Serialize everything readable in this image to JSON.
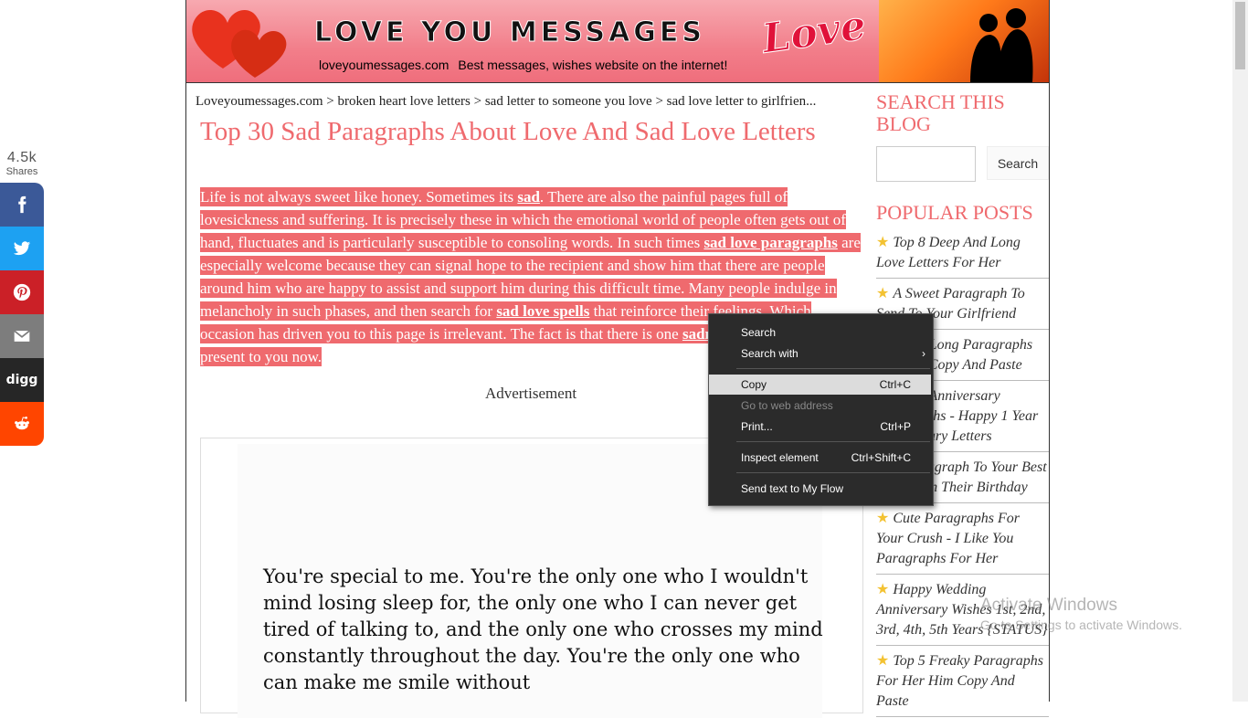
{
  "share": {
    "count": "4.5k",
    "count_label": "Shares",
    "buttons": [
      {
        "name": "facebook",
        "color": "#3b5998"
      },
      {
        "name": "twitter",
        "color": "#1da1f2"
      },
      {
        "name": "pinterest",
        "color": "#cb2027"
      },
      {
        "name": "email",
        "color": "#7d7d7d"
      },
      {
        "name": "digg",
        "color": "#262626"
      },
      {
        "name": "reddit",
        "color": "#ff4500"
      }
    ]
  },
  "banner": {
    "logo": "LOVE YOU MESSAGES",
    "site": "loveyoumessages.com",
    "tagline": "Best messages, wishes website on the internet!",
    "love_script": "Love"
  },
  "breadcrumb": "Loveyoumessages.com > broken heart love letters > sad letter to someone you love > sad love letter to girlfrien...",
  "title": "Top 30 Sad Paragraphs About Love And Sad Love Letters",
  "intro": {
    "p1": "Life is not always sweet like honey. Sometimes its ",
    "k1": "sad",
    "p2": ". There are also the painful pages full of lovesickness and suffering. It is precisely these in which the emotional world of people often gets out of hand, fluctuates and is particularly susceptible to consoling words. In such times ",
    "k2": "sad love paragraphs",
    "p3": " are especially welcome because they can signal hope to the recipient and show him that there are people around him who are happy to assist and support him during this difficult time. Many people indulge in melancholy in such phases, and then search for ",
    "k3": "sad love spells",
    "p4": " that reinforce their feelings. Which occasion has driven you to this page is irrelevant. The fact is that there is one ",
    "k4": "sadness",
    "p5": " or another that we present to you now."
  },
  "ad_label": "Advertisement",
  "quote_image_text": "You're special to me. You're the only one who I wouldn't mind losing sleep for, the only one who I can never get tired of talking to, and the only one who crosses my mind constantly throughout the day. You're the only one who can make me smile without",
  "sidebar": {
    "search_heading": "SEARCH THIS BLOG",
    "search_button": "Search",
    "search_placeholder": "",
    "popular_heading": "POPULAR POSTS",
    "posts": [
      "Top 8 Deep And Long Love Letters For Her",
      "A Sweet Paragraph To Send To Your Girlfriend",
      "Top 5 Long Paragraphs For Her Copy And Paste",
      "Top 5 Anniversary Paragraphs - Happy 1 Year Anniversary Letters",
      "A Paragraph To Your Best Friend On Their Birthday",
      "Cute Paragraphs For Your Crush - I Like You Paragraphs For Her",
      "Happy Wedding Anniversary Wishes 1st, 2nd, 3rd, 4th, 5th Years {STATUS}",
      "Top 5 Freaky Paragraphs For Her Him Copy And Paste"
    ]
  },
  "context_menu": {
    "items": [
      {
        "label": "Search",
        "shortcut": ""
      },
      {
        "label": "Search with",
        "shortcut": ""
      },
      {
        "label": "Copy",
        "shortcut": "Ctrl+C"
      },
      {
        "label": "Go to web address",
        "shortcut": ""
      },
      {
        "label": "Print...",
        "shortcut": "Ctrl+P"
      },
      {
        "label": "Inspect element",
        "shortcut": "Ctrl+Shift+C"
      },
      {
        "label": "Send text to My Flow",
        "shortcut": ""
      }
    ]
  },
  "activate_windows": {
    "title": "Activate Windows",
    "subtitle": "Go to Settings to activate Windows."
  }
}
